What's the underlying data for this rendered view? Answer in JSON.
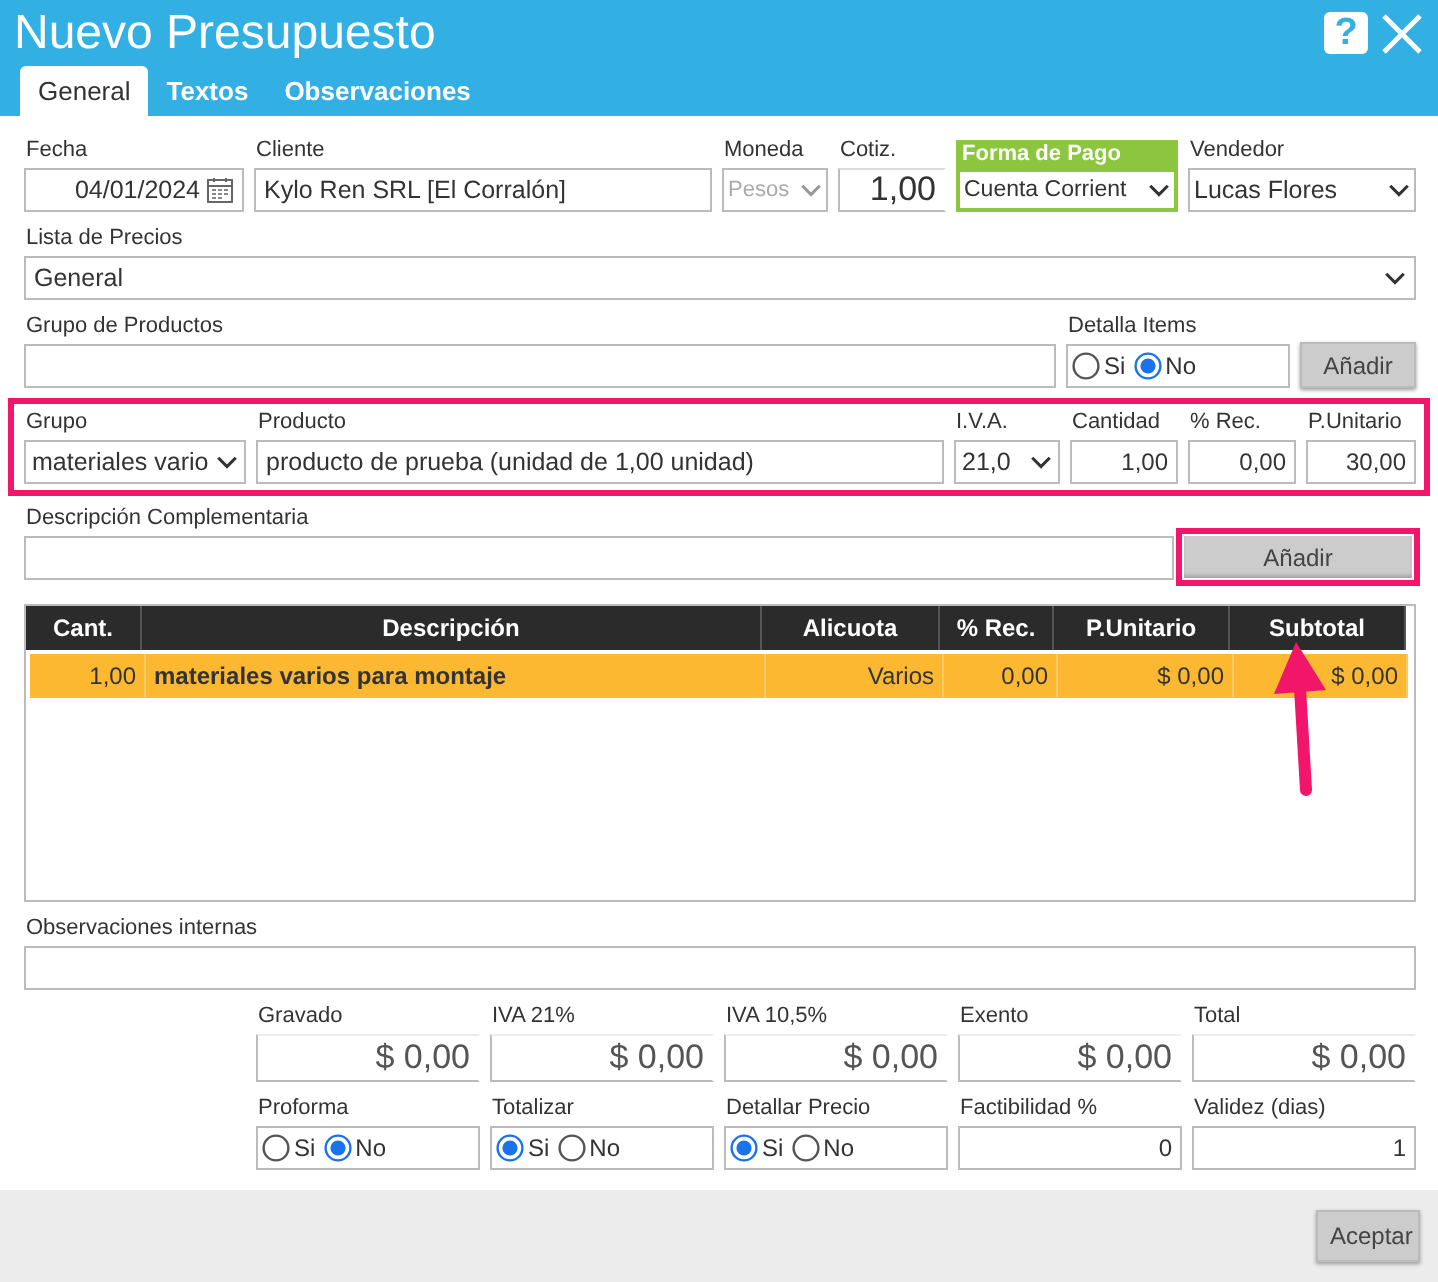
{
  "window": {
    "title": "Nuevo Presupuesto",
    "help": "?"
  },
  "tabs": [
    {
      "label": "General",
      "selected": true
    },
    {
      "label": "Textos",
      "selected": false
    },
    {
      "label": "Observaciones",
      "selected": false
    }
  ],
  "form_rows": [
    {
      "annotated": false,
      "fields": [
        {
          "kind": "date",
          "label": "Fecha",
          "value": "04/01/2024",
          "disabled": false,
          "highlighted": false
        },
        {
          "kind": "text",
          "label": "Cliente",
          "value": "Kylo Ren SRL [El Corralón]",
          "disabled": false,
          "highlighted": false
        },
        {
          "kind": "select",
          "label": "Moneda",
          "value": "Pesos",
          "disabled": true,
          "highlighted": false
        },
        {
          "kind": "bignum",
          "label": "Cotiz.",
          "value": "1,00",
          "disabled": false,
          "highlighted": false
        },
        {
          "kind": "select",
          "label": "Forma de Pago",
          "value": "Cuenta Corrient",
          "disabled": false,
          "highlighted": true
        },
        {
          "kind": "select",
          "label": "Vendedor",
          "value": "Lucas Flores",
          "disabled": false,
          "highlighted": false
        }
      ]
    },
    {
      "annotated": false,
      "fields": [
        {
          "kind": "select",
          "label": "Lista de Precios",
          "value": "General",
          "disabled": false,
          "highlighted": false
        }
      ]
    },
    {
      "annotated": false,
      "fields": [
        {
          "kind": "text",
          "label": "Grupo de Productos",
          "highlighted": false
        },
        {
          "kind": "radio",
          "label": "Detalla Items",
          "options": [
            {
              "label": "Si",
              "selected": false
            },
            {
              "label": "No",
              "selected": true
            }
          ]
        },
        {
          "kind": "button",
          "label": "Añadir",
          "annotated": false
        }
      ]
    },
    {
      "annotated": true,
      "fields": [
        {
          "kind": "select",
          "label": "Grupo",
          "value": "materiales vario",
          "disabled": false,
          "highlighted": false
        },
        {
          "kind": "text",
          "label": "Producto",
          "value": "producto de prueba (unidad de 1,00 unidad)",
          "disabled": false,
          "highlighted": false
        },
        {
          "kind": "select",
          "label": "I.V.A.",
          "value": "21,0",
          "disabled": false,
          "highlighted": false
        },
        {
          "kind": "number",
          "label": "Cantidad",
          "value": "1,00",
          "disabled": false,
          "highlighted": false
        },
        {
          "kind": "number",
          "label": "% Rec.",
          "value": "0,00",
          "disabled": false,
          "highlighted": false
        },
        {
          "kind": "number",
          "label": "P.Unitario",
          "value": "30,00",
          "disabled": false,
          "highlighted": false
        }
      ]
    },
    {
      "annotated": false,
      "fields": [
        {
          "kind": "text",
          "label": "Descripción Complementaria",
          "highlighted": false
        },
        {
          "kind": "button",
          "label": "Añadir",
          "annotated": true
        }
      ]
    }
  ],
  "table": {
    "columns": [
      "Cant.",
      "Descripción",
      "Alicuota",
      "% Rec.",
      "P.Unitario",
      "Subtotal"
    ],
    "rows": [
      {
        "selected": true,
        "cells": [
          "1,00",
          "materiales varios para montaje",
          "Varios",
          "0,00",
          "$ 0,00",
          "$ 0,00"
        ]
      }
    ]
  },
  "bottom_rows": [
    {
      "annotated": false,
      "fields": [
        {
          "kind": "text",
          "label": "Observaciones internas",
          "highlighted": false
        }
      ]
    },
    {
      "annotated": false,
      "fields": [
        {
          "kind": "money",
          "label": "Gravado",
          "value": "$ 0,00",
          "disabled": false,
          "highlighted": false
        },
        {
          "kind": "money",
          "label": "IVA 21%",
          "value": "$ 0,00",
          "disabled": false,
          "highlighted": false
        },
        {
          "kind": "money",
          "label": "IVA 10,5%",
          "value": "$ 0,00",
          "disabled": false,
          "highlighted": false
        },
        {
          "kind": "money",
          "label": "Exento",
          "value": "$ 0,00",
          "disabled": false,
          "highlighted": false
        },
        {
          "kind": "money",
          "label": "Total",
          "value": "$ 0,00",
          "disabled": false,
          "highlighted": false
        }
      ]
    },
    {
      "annotated": false,
      "fields": [
        {
          "kind": "radio",
          "label": "Proforma",
          "options": [
            {
              "label": "Si",
              "selected": false
            },
            {
              "label": "No",
              "selected": true
            }
          ]
        },
        {
          "kind": "radio",
          "label": "Totalizar",
          "options": [
            {
              "label": "Si",
              "selected": true
            },
            {
              "label": "No",
              "selected": false
            }
          ]
        },
        {
          "kind": "radio",
          "label": "Detallar Precio",
          "options": [
            {
              "label": "Si",
              "selected": true
            },
            {
              "label": "No",
              "selected": false
            }
          ]
        },
        {
          "kind": "number",
          "label": "Factibilidad %",
          "value": "0",
          "disabled": false,
          "highlighted": false
        },
        {
          "kind": "number",
          "label": "Validez (dias)",
          "value": "1",
          "disabled": false,
          "highlighted": false
        }
      ]
    }
  ],
  "footer": {
    "button": "Aceptar"
  }
}
